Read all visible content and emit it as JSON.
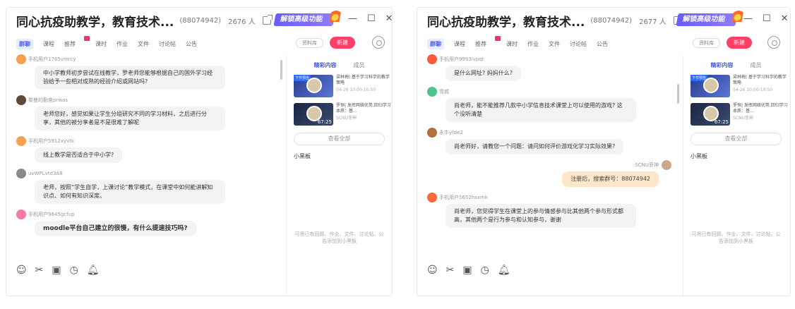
{
  "left": {
    "title": "同心抗疫助教学，教育技术...",
    "group_id": "(88074942)",
    "members": "2676 人",
    "promo": "解锁高级功能",
    "tabs": [
      "群聊",
      "课程",
      "推荐",
      "课时",
      "作业",
      "文件",
      "讨论帖",
      "公告"
    ],
    "ziliao": "资料库",
    "live": "新建",
    "messages": [
      {
        "user": "手机用户1765vmrcy",
        "text": "中小学教师初步尝试在线教学，罗老师您能够根据自己的国外学习经验给予一些相对成熟的经验介绍或网站吗?",
        "bold": false,
        "avatar": "#f6a04d"
      },
      {
        "user": "黎曼的勤奋prwas",
        "text": "老师您好，感觉如果让学生分组研究不同的学习材料，之后进行分享，其他的被分享者是不是很难了解呢",
        "bold": false,
        "avatar": "#5b4a3a"
      },
      {
        "user": "手机用户5912xyvtk",
        "text": "线上教学是否适合于中小学?",
        "bold": false,
        "avatar": "#f6a04d"
      },
      {
        "user": "uvWPLvtd3A8",
        "text": "老师，按照“学生自学，上课讨论”教学模式，在课堂中如何能讲解知识点、如何有知识深度。",
        "bold": false,
        "avatar": "#8a8a8a"
      },
      {
        "user": "手机用户9645gcfup",
        "text": "moodle平台自己建立的很慢，有什么提速技巧吗?",
        "bold": true,
        "avatar": "#f57aa8"
      }
    ],
    "panel": {
      "tab_content": "精彩内容",
      "tab_members": "成员",
      "cards": [
        {
          "label": "下节预告",
          "title": "梁林梅| 基于学习科学的教学策略",
          "sub": "04-26 10:00-10:50",
          "duration": ""
        },
        {
          "label": "",
          "title": "罗恒| 发挥网络优势,回归学习本质：基...",
          "sub": "SCNU菲神",
          "duration": "67:25"
        }
      ],
      "view_all": "查看全部",
      "board": "小黑板",
      "hint": "可将已有回顾、作业、文件、讨论帖、公告添加到小黑板"
    }
  },
  "right": {
    "title": "同心抗疫助教学，教育技术...",
    "group_id": "(88074942)",
    "members": "2677 人",
    "promo": "解锁高级功能",
    "tabs": [
      "群聊",
      "课程",
      "推荐",
      "课时",
      "作业",
      "文件",
      "讨论帖",
      "公告"
    ],
    "ziliao": "资料库",
    "live": "新建",
    "messages": [
      {
        "user": "手机用户9993ivpqt",
        "text": "是什么网址? 妈妈什么?",
        "bold": false,
        "avatar": "#ff5a3c"
      },
      {
        "user": "雪戚",
        "text": "尚老师，能不能推荐几款中小学信息技术课堂上可以使用的游戏? 这个没听清楚",
        "bold": false,
        "avatar": "#4cc48a"
      },
      {
        "user": "永牛yfde2",
        "text": "尚老师好，请教您一个问题：请问如何评价游戏化学习实际效果?",
        "bold": false,
        "avatar": "#b0703c"
      },
      {
        "user": "手机用户5652hsxmk",
        "text": "尚老师，您觉得学生在课堂上的参与情感参与比其他两个参与形式都高，其他两个是行为参与和认知参与，谢谢",
        "bold": false,
        "avatar": "#ff6a3c"
      }
    ],
    "self_message": {
      "user": "SCNU菲神",
      "text": "注册后，搜索群号：88074942"
    },
    "panel": {
      "tab_content": "精彩内容",
      "tab_members": "成员",
      "cards": [
        {
          "label": "下节预告",
          "title": "梁林梅| 基于学习科学的教学策略",
          "sub": "04-26 10:00-10:50",
          "duration": ""
        },
        {
          "label": "",
          "title": "罗恒| 发挥网络优势,回归学习本质：基...",
          "sub": "SCNU菲神",
          "duration": "67:25"
        }
      ],
      "view_all": "查看全部",
      "board": "小黑板",
      "hint": "可将已有回顾、作业、文件、讨论帖、公告添加到小黑板"
    }
  },
  "toolbar_icons": [
    "smile-icon",
    "scissors-icon",
    "image-icon",
    "clock-icon",
    "bell-icon"
  ],
  "window_controls": {
    "minimize": "—",
    "maximize": "☐",
    "close": "✕"
  }
}
